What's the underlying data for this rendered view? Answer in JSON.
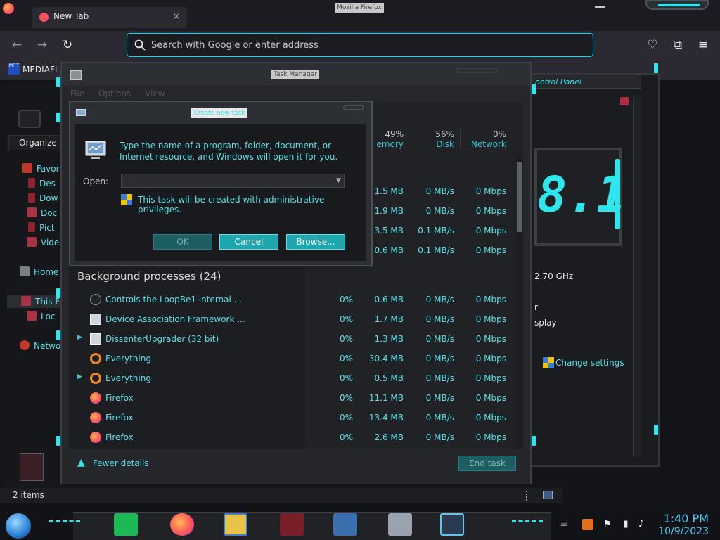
{
  "firefox": {
    "window_title": "Mozilla Firefox",
    "tab_label": "New Tab",
    "tab_close": "×",
    "url_placeholder": "Search with Google or enter address",
    "bookmark_label": "MEDIAFI"
  },
  "explorer": {
    "organize_label": "Organize",
    "nav": [
      {
        "label": "Favor",
        "icon": "star-icon"
      },
      {
        "label": "Des",
        "icon": "desktop-icon"
      },
      {
        "label": "Dow",
        "icon": "download-icon"
      },
      {
        "label": "Doc",
        "icon": "documents-icon"
      },
      {
        "label": "Pict",
        "icon": "pictures-icon"
      },
      {
        "label": "Vide",
        "icon": "videos-icon"
      }
    ],
    "home_label": "Home",
    "this_pc_label": "This F",
    "local_label": "Loc",
    "network_label": "Netwo",
    "status_items": "2 items"
  },
  "control_panel": {
    "title": "ontrol Panel",
    "version_text": "8.1",
    "cpu_speed": "2.70 GHz",
    "line_r": "r",
    "line_display": "splay",
    "change_settings": "Change settings"
  },
  "task_manager": {
    "title": "Task Manager",
    "menu": [
      "File",
      "Options",
      "View"
    ],
    "headers": {
      "memory_pct": "49%",
      "memory_label": "emory",
      "disk_pct": "56%",
      "disk_label": "Disk",
      "network_pct": "0%",
      "network_label": "Network"
    },
    "app_rows": [
      {
        "mem": "1.5 MB",
        "disk": "0 MB/s",
        "net": "0 Mbps"
      },
      {
        "mem": "1.9 MB",
        "disk": "0 MB/s",
        "net": "0 Mbps"
      },
      {
        "mem": "3.5 MB",
        "disk": "0.1 MB/s",
        "net": "0 Mbps"
      },
      {
        "mem": "0.6 MB",
        "disk": "0.1 MB/s",
        "net": "0 Mbps"
      }
    ],
    "background_label": "Background processes (24)",
    "processes": [
      {
        "name": "Controls the LoopBe1 internal ...",
        "cpu": "0%",
        "mem": "0.6 MB",
        "disk": "0 MB/s",
        "net": "0 Mbps",
        "icon": "loopbe-icon",
        "expandable": false
      },
      {
        "name": "Device Association Framework ...",
        "cpu": "0%",
        "mem": "1.7 MB",
        "disk": "0 MB/s",
        "net": "0 Mbps",
        "icon": "service-icon",
        "expandable": false
      },
      {
        "name": "DissenterUpgrader (32 bit)",
        "cpu": "0%",
        "mem": "1.3 MB",
        "disk": "0 MB/s",
        "net": "0 Mbps",
        "icon": "service-icon",
        "expandable": true
      },
      {
        "name": "Everything",
        "cpu": "0%",
        "mem": "30.4 MB",
        "disk": "0 MB/s",
        "net": "0 Mbps",
        "icon": "everything-icon",
        "expandable": false
      },
      {
        "name": "Everything",
        "cpu": "0%",
        "mem": "0.5 MB",
        "disk": "0 MB/s",
        "net": "0 Mbps",
        "icon": "everything-icon",
        "expandable": true
      },
      {
        "name": "Firefox",
        "cpu": "0%",
        "mem": "11.1 MB",
        "disk": "0 MB/s",
        "net": "0 Mbps",
        "icon": "firefox-icon",
        "expandable": false
      },
      {
        "name": "Firefox",
        "cpu": "0%",
        "mem": "13.4 MB",
        "disk": "0 MB/s",
        "net": "0 Mbps",
        "icon": "firefox-icon",
        "expandable": false
      },
      {
        "name": "Firefox",
        "cpu": "0%",
        "mem": "2.6 MB",
        "disk": "0 MB/s",
        "net": "0 Mbps",
        "icon": "firefox-icon",
        "expandable": false
      }
    ],
    "fewer_details": "Fewer details",
    "end_task": "End task"
  },
  "run_dialog": {
    "title": "Create new task",
    "description": "Type the name of a program, folder, document, or Internet resource, and Windows will open it for you.",
    "open_label": "Open:",
    "open_value": "",
    "admin_note": "This task will be created with administrative privileges.",
    "ok_label": "OK",
    "cancel_label": "Cancel",
    "browse_label": "Browse..."
  },
  "taskbar": {
    "time": "1:40 PM",
    "date": "10/9/2023"
  },
  "colors": {
    "accent_cyan": "#2ee6ee",
    "text_cyan": "#59e0e8",
    "button_teal": "#1fa6ae"
  }
}
